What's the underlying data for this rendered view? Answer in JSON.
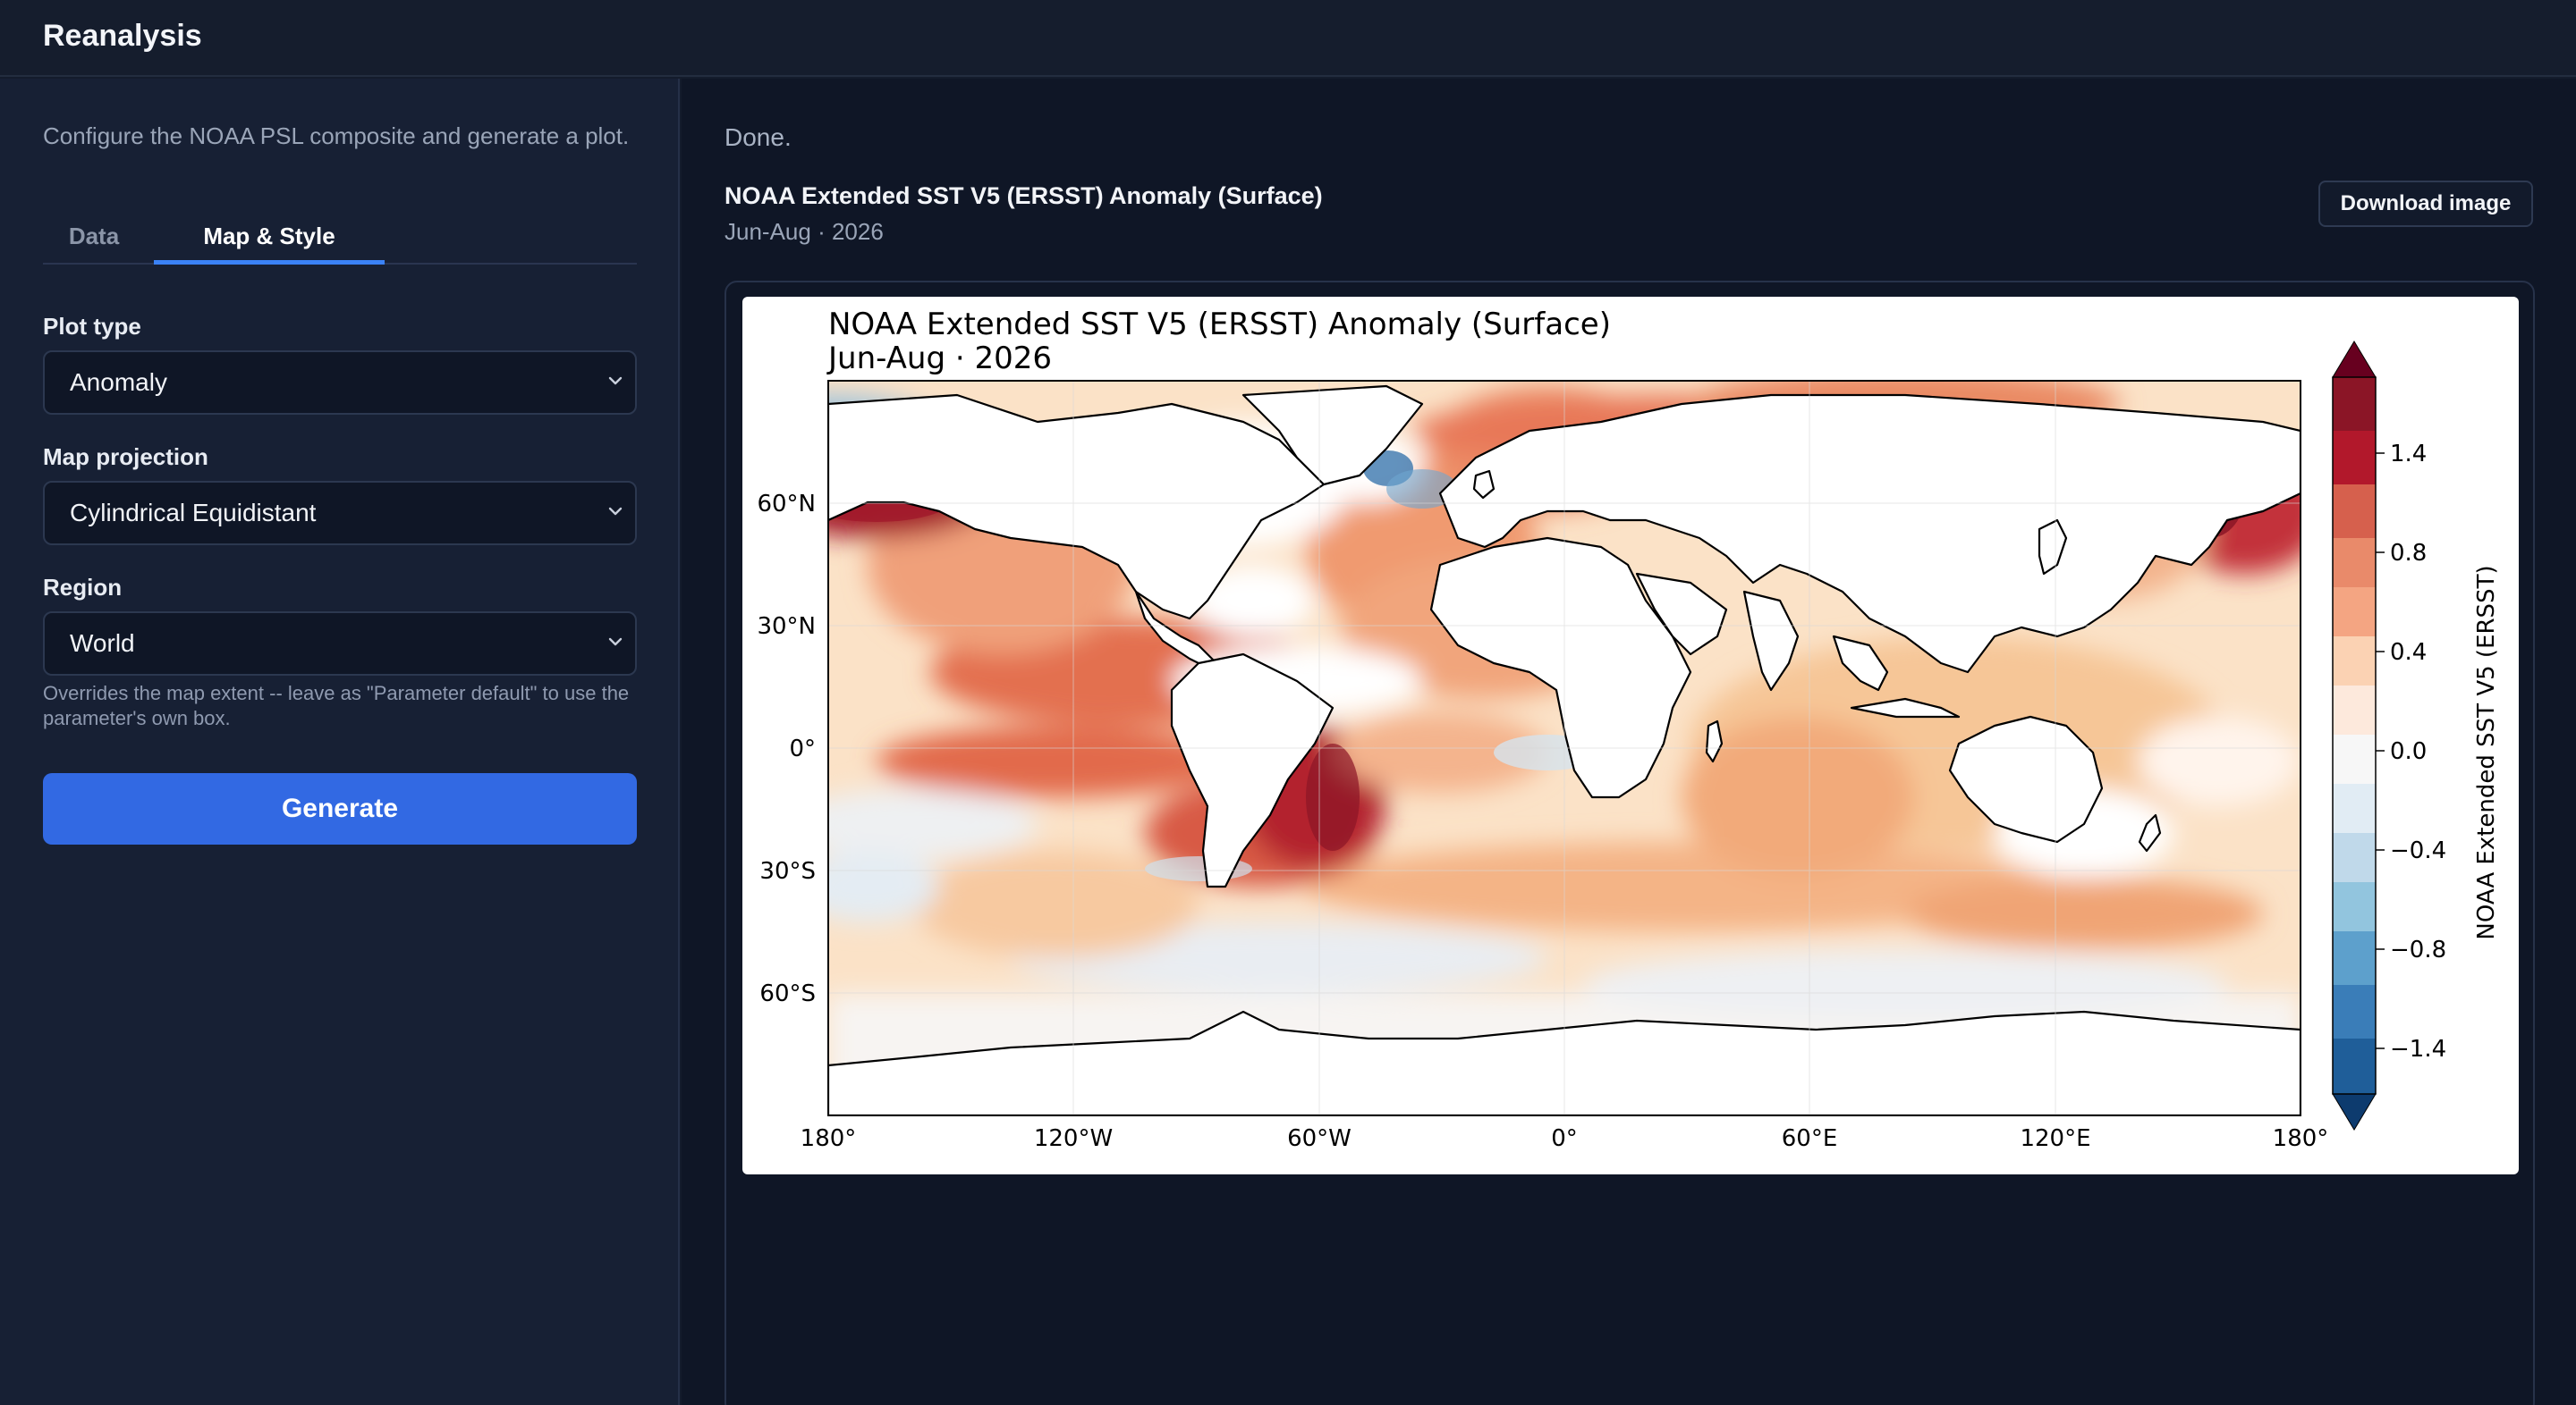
{
  "app": {
    "title": "Reanalysis"
  },
  "sidebar": {
    "intro": "Configure the NOAA PSL composite and generate a plot.",
    "tabs": [
      {
        "label": "Data"
      },
      {
        "label": "Map & Style"
      }
    ],
    "active_tab": "Map & Style",
    "fields": {
      "plot_type": {
        "label": "Plot type",
        "value": "Anomaly"
      },
      "projection": {
        "label": "Map projection",
        "value": "Cylindrical Equidistant"
      },
      "region": {
        "label": "Region",
        "value": "World",
        "help": "Overrides the map extent -- leave as \"Parameter default\" to use the parameter's own box."
      }
    },
    "generate_label": "Generate"
  },
  "main": {
    "status": "Done.",
    "plot_title": "NOAA Extended SST V5 (ERSST) Anomaly (Surface)",
    "plot_subtitle": "Jun-Aug · 2026",
    "download_label": "Download image"
  },
  "figure": {
    "title_line1": "NOAA Extended SST V5 (ERSST) Anomaly (Surface)",
    "title_line2": "Jun-Aug · 2026",
    "lon_ticks": [
      "180°",
      "120°W",
      "60°W",
      "0°",
      "60°E",
      "120°E",
      "180°"
    ],
    "lat_ticks": [
      "60°N",
      "30°N",
      "0°",
      "30°S",
      "60°S"
    ],
    "colorbar_label": "NOAA Extended SST V5 (ERSST)",
    "colorbar_ticks": [
      "1.4",
      "0.8",
      "0.4",
      "0.0",
      "−0.4",
      "−0.8",
      "−1.4"
    ],
    "colormap": "RdBu_r"
  },
  "chart_data": {
    "type": "heatmap",
    "title": "NOAA Extended SST V5 (ERSST) Anomaly (Surface)",
    "subtitle": "Jun-Aug · 2026",
    "xlabel": "",
    "ylabel": "",
    "x_ticks": [
      "180°",
      "120°W",
      "60°W",
      "0°",
      "60°E",
      "120°E",
      "180°"
    ],
    "y_ticks": [
      "60°N",
      "30°N",
      "0°",
      "30°S",
      "60°S"
    ],
    "colorbar": {
      "label": "NOAA Extended SST V5 (ERSST)",
      "ticks": [
        -1.4,
        -0.8,
        -0.4,
        0.0,
        0.4,
        0.8,
        1.4
      ],
      "extend": "both",
      "colors": [
        "#08306b",
        "#2166ac",
        "#4393c3",
        "#92c5de",
        "#d1e5f0",
        "#f7f7f7",
        "#fddbc7",
        "#f4a582",
        "#d6604d",
        "#b2182b",
        "#67001f"
      ]
    },
    "xlim": [
      -180,
      180
    ],
    "ylim": [
      -90,
      90
    ]
  }
}
